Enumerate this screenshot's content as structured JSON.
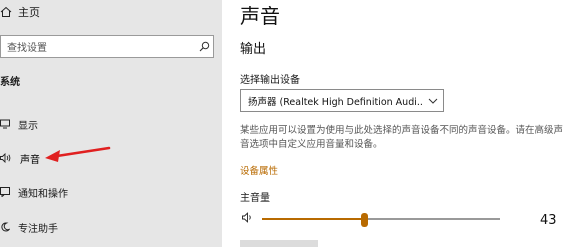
{
  "sidebar": {
    "home_label": "主页",
    "search_placeholder": "查找设置",
    "section_title": "系统",
    "items": [
      {
        "label": "显示",
        "icon": "monitor-icon"
      },
      {
        "label": "声音",
        "icon": "speaker-icon"
      },
      {
        "label": "通知和操作",
        "icon": "notification-icon"
      },
      {
        "label": "专注助手",
        "icon": "moon-icon"
      }
    ]
  },
  "main": {
    "title": "声音",
    "output_heading": "输出",
    "device_label": "选择输出设备",
    "device_value": "扬声器 (Realtek High Definition Audi...",
    "description": "某些应用可以设置为使用与此处选择的声音设备不同的声音设备。请在高级声音选项中自定义应用音量和设备。",
    "device_properties_link": "设备属性",
    "master_volume_label": "主音量",
    "volume": 43
  },
  "colors": {
    "accent": "#b86a00",
    "annotation_arrow": "#e02020",
    "sidebar_bg": "#e6e6e6"
  }
}
